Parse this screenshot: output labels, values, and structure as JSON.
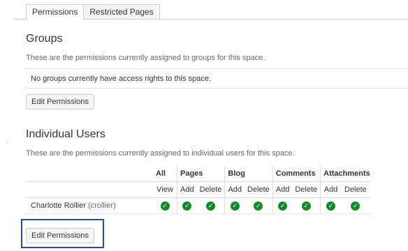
{
  "tabs": [
    {
      "label": "Permissions",
      "active": true
    },
    {
      "label": "Restricted Pages",
      "active": false
    }
  ],
  "groups": {
    "title": "Groups",
    "description": "These are the permissions currently assigned to groups for this space.",
    "empty_message": "No groups currently have access rights to this space.",
    "edit_button": "Edit Permissions"
  },
  "individual": {
    "title": "Individual Users",
    "description": "These are the permissions currently assigned to individual users for this space.",
    "column_groups": [
      "All",
      "Pages",
      "Blog",
      "Comments",
      "Attachments"
    ],
    "subcolumns": {
      "all_view": "View",
      "pages_add": "Add",
      "pages_delete": "Delete",
      "blog_add": "Add",
      "blog_delete": "Delete",
      "comments_add": "Add",
      "comments_delete": "Delete",
      "attachments_add": "Add",
      "attachments_delete": "Delete"
    },
    "users": [
      {
        "name": "Charlotte Rollier",
        "username": "(crollier)",
        "permissions": [
          true,
          true,
          true,
          true,
          true,
          true,
          true,
          true,
          true
        ]
      }
    ],
    "edit_button": "Edit Permissions"
  },
  "colors": {
    "check_green": "#14892c",
    "highlight_border": "#2b4c78"
  },
  "icons": {
    "granted": "check-circle-icon",
    "drag": "ellipsis-icon"
  }
}
